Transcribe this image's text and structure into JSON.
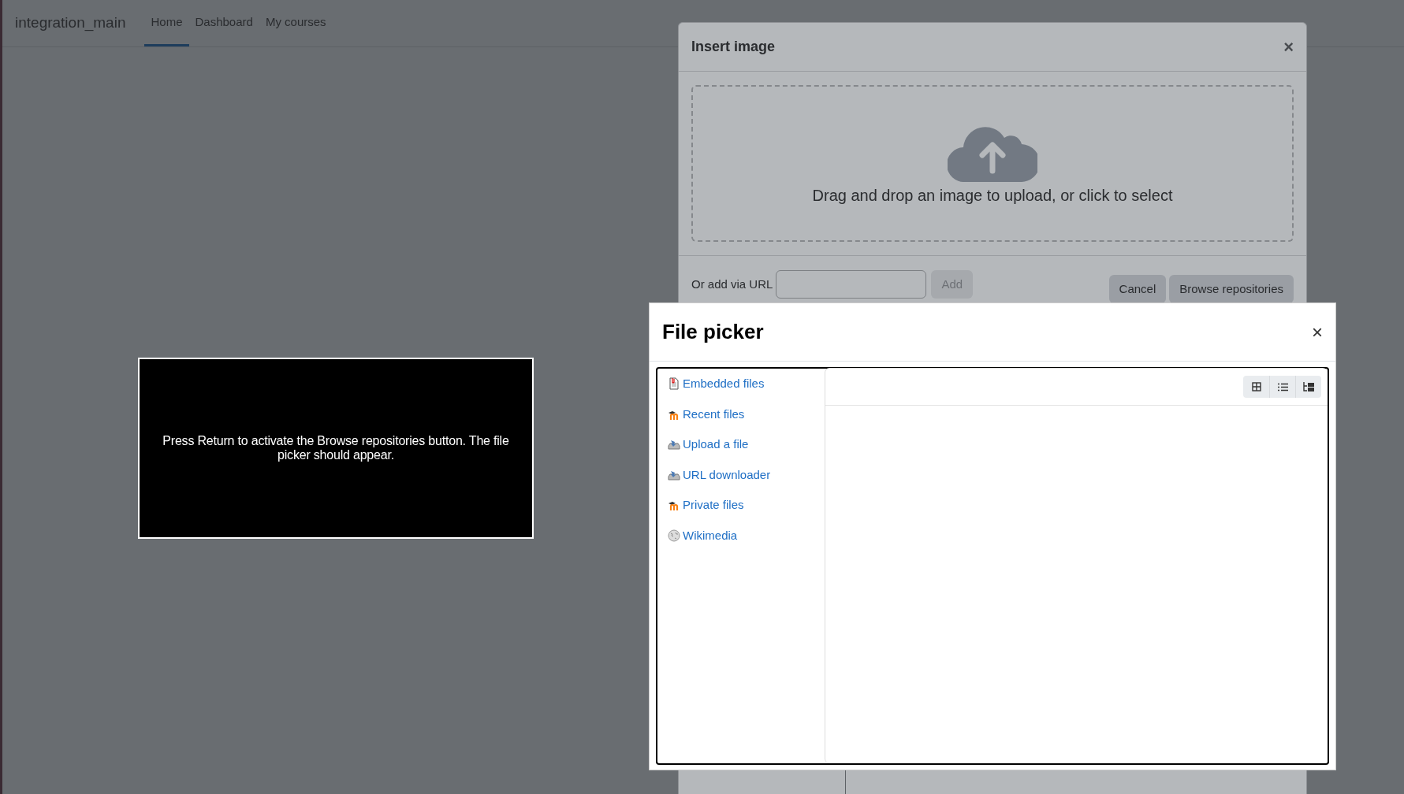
{
  "nav": {
    "brand": "integration_main",
    "items": [
      {
        "label": "Home",
        "selected": true
      },
      {
        "label": "Dashboard",
        "selected": false
      },
      {
        "label": "My courses",
        "selected": false
      }
    ]
  },
  "insert_image": {
    "title": "Insert image",
    "close": "×",
    "drop_text": "Drag and drop an image to upload, or click to select",
    "url_label": "Or add via URL",
    "add_button": {
      "label": "Add",
      "disabled": true
    },
    "buttons": [
      "Cancel",
      "Browse repositories"
    ]
  },
  "message_box": {
    "text": "Press Return to activate the Browse repositories button. The file picker should appear."
  },
  "file_picker": {
    "title": "File picker",
    "close": "×",
    "repositories": [
      {
        "label": "Embedded files",
        "kind": "embedded"
      },
      {
        "label": "Recent files",
        "kind": "moodle"
      },
      {
        "label": "Upload a file",
        "kind": "upload"
      },
      {
        "label": "URL downloader",
        "kind": "upload"
      },
      {
        "label": "Private files",
        "kind": "moodle"
      },
      {
        "label": "Wikimedia",
        "kind": "wiki"
      }
    ],
    "view_buttons": [
      {
        "kind": "icons"
      },
      {
        "kind": "list"
      },
      {
        "kind": "tree"
      }
    ]
  }
}
